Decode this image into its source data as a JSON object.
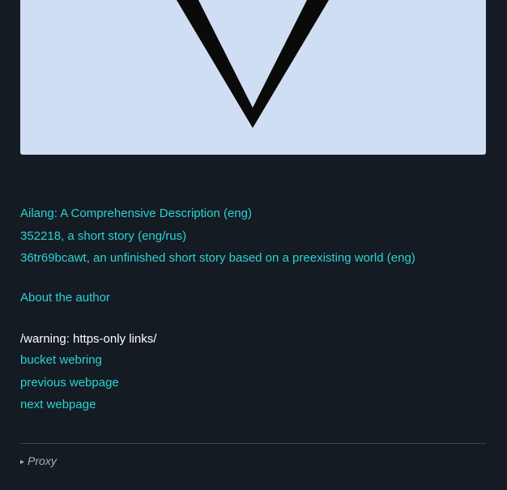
{
  "links_primary": [
    {
      "label": "Ailang: A Comprehensive Description (eng)"
    },
    {
      "label": "352218, a short story (eng/rus)"
    },
    {
      "label": "36tr69bcawt, an unfinished short story based on a preexisting world (eng)"
    }
  ],
  "about": {
    "label": "About the author"
  },
  "warning": {
    "text": "/warning: https-only links/"
  },
  "links_nav": [
    {
      "label": "bucket webring"
    },
    {
      "label": "previous webpage"
    },
    {
      "label": "next webpage"
    }
  ],
  "proxy": {
    "label": "Proxy",
    "icon": "triangle-right-icon"
  },
  "colors": {
    "background": "#151b23",
    "link": "#2ad3d3",
    "hero_background": "#cfdef3",
    "text": "#ffffff",
    "muted": "#a9b0b8"
  }
}
